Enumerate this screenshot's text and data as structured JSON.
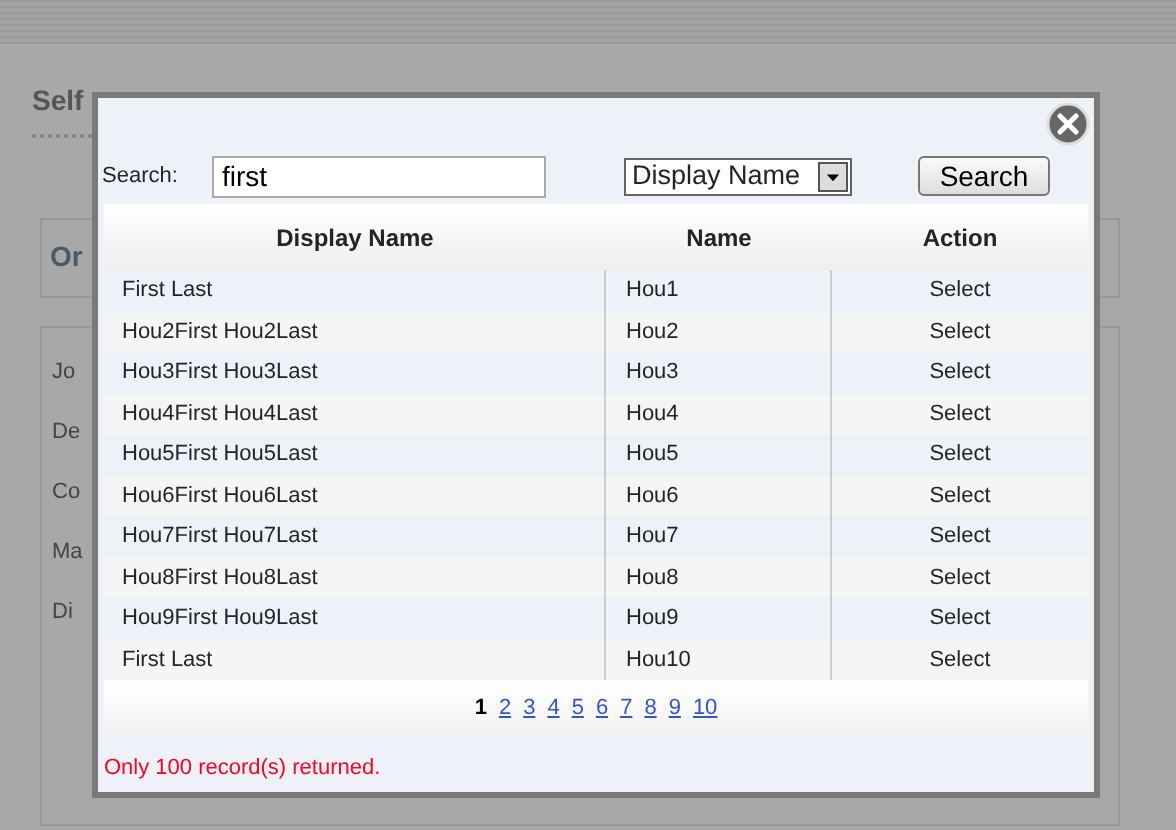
{
  "background": {
    "section_title": "Self",
    "panel_title": "Or",
    "field_labels": [
      "Jo",
      "De",
      "Co",
      "Ma",
      "Di"
    ]
  },
  "dialog": {
    "search_label": "Search:",
    "search_value": "first",
    "field_select": "Display Name",
    "search_button": "Search",
    "table": {
      "columns": [
        "Display Name",
        "Name",
        "Action"
      ],
      "rows": [
        {
          "display_name": "First Last",
          "name": "Hou1",
          "action": "Select"
        },
        {
          "display_name": "Hou2First Hou2Last",
          "name": "Hou2",
          "action": "Select"
        },
        {
          "display_name": "Hou3First Hou3Last",
          "name": "Hou3",
          "action": "Select"
        },
        {
          "display_name": "Hou4First Hou4Last",
          "name": "Hou4",
          "action": "Select"
        },
        {
          "display_name": "Hou5First Hou5Last",
          "name": "Hou5",
          "action": "Select"
        },
        {
          "display_name": "Hou6First Hou6Last",
          "name": "Hou6",
          "action": "Select"
        },
        {
          "display_name": "Hou7First Hou7Last",
          "name": "Hou7",
          "action": "Select"
        },
        {
          "display_name": "Hou8First Hou8Last",
          "name": "Hou8",
          "action": "Select"
        },
        {
          "display_name": "Hou9First Hou9Last",
          "name": "Hou9",
          "action": "Select"
        },
        {
          "display_name": "First Last",
          "name": "Hou10",
          "action": "Select"
        }
      ]
    },
    "pages": [
      {
        "label": "1",
        "selected": true
      },
      {
        "label": "2",
        "selected": false
      },
      {
        "label": "3",
        "selected": false
      },
      {
        "label": "4",
        "selected": false
      },
      {
        "label": "5",
        "selected": false
      },
      {
        "label": "6",
        "selected": false
      },
      {
        "label": "7",
        "selected": false
      },
      {
        "label": "8",
        "selected": false
      },
      {
        "label": "9",
        "selected": false
      },
      {
        "label": "10",
        "selected": false
      }
    ],
    "message": "Only 100 record(s) returned."
  }
}
